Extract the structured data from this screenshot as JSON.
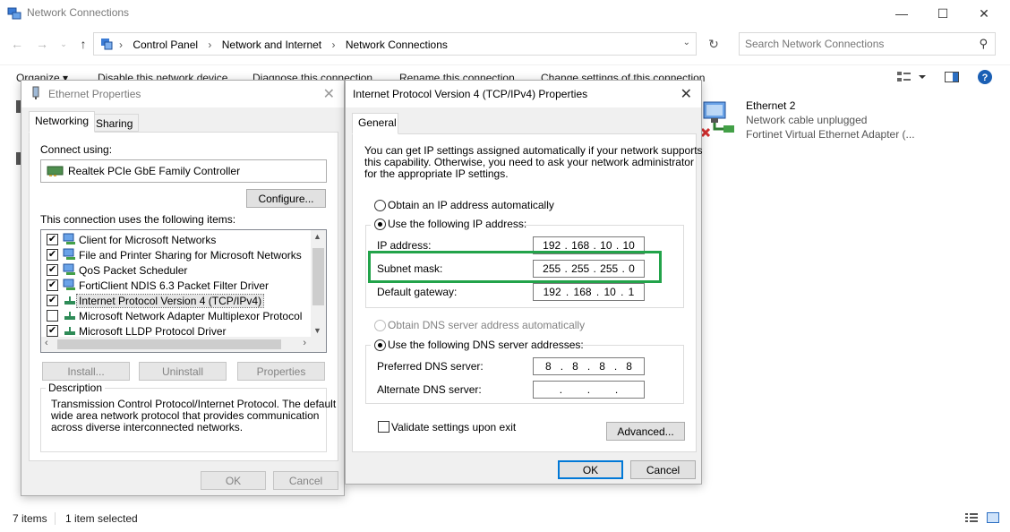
{
  "explorer": {
    "title": "Network Connections",
    "breadcrumbs": [
      "Control Panel",
      "Network and Internet",
      "Network Connections"
    ],
    "search_placeholder": "Search Network Connections",
    "commands": [
      "Organize ▾",
      "Disable this network device",
      "Diagnose this connection",
      "Rename this connection",
      "Change settings of this connection"
    ],
    "items": [
      {
        "name": "Ethernet 2",
        "status": "Network cable unplugged",
        "adapter": "Fortinet Virtual Ethernet Adapter (..."
      }
    ],
    "status": {
      "count": "7 items",
      "selected": "1 item selected"
    }
  },
  "eth_props": {
    "title": "Ethernet Properties",
    "tabs": [
      "Networking",
      "Sharing"
    ],
    "connect_using_label": "Connect using:",
    "adapter": "Realtek PCIe GbE Family Controller",
    "configure": "Configure...",
    "items_label": "This connection uses the following items:",
    "items": [
      {
        "label": "Client for Microsoft Networks",
        "checked": true
      },
      {
        "label": "File and Printer Sharing for Microsoft Networks",
        "checked": true
      },
      {
        "label": "QoS Packet Scheduler",
        "checked": true
      },
      {
        "label": "FortiClient NDIS 6.3 Packet Filter Driver",
        "checked": true
      },
      {
        "label": "Internet Protocol Version 4 (TCP/IPv4)",
        "checked": true
      },
      {
        "label": "Microsoft Network Adapter Multiplexor Protocol",
        "checked": false
      },
      {
        "label": "Microsoft LLDP Protocol Driver",
        "checked": true
      }
    ],
    "install": "Install...",
    "uninstall": "Uninstall",
    "properties": "Properties",
    "description_label": "Description",
    "description": [
      "Transmission Control Protocol/Internet Protocol. The default",
      "wide area network protocol that provides communication",
      "across diverse interconnected networks."
    ],
    "ok": "OK",
    "cancel": "Cancel"
  },
  "ipv4": {
    "title": "Internet Protocol Version 4 (TCP/IPv4) Properties",
    "tab": "General",
    "intro": [
      "You can get IP settings assigned automatically if your network supports",
      "this capability. Otherwise, you need to ask your network administrator",
      "for the appropriate IP settings."
    ],
    "auto_ip": "Obtain an IP address automatically",
    "manual_ip": "Use the following IP address:",
    "ip_label": "IP address:",
    "ip": [
      "192",
      "168",
      "10",
      "10"
    ],
    "mask_label": "Subnet mask:",
    "mask": [
      "255",
      "255",
      "255",
      "0"
    ],
    "gw_label": "Default gateway:",
    "gw": [
      "192",
      "168",
      "10",
      "1"
    ],
    "auto_dns": "Obtain DNS server address automatically",
    "manual_dns": "Use the following DNS server addresses:",
    "pdns_label": "Preferred DNS server:",
    "pdns": [
      "8",
      "8",
      "8",
      "8"
    ],
    "adns_label": "Alternate DNS server:",
    "adns": [
      "",
      "",
      "",
      ""
    ],
    "validate": "Validate settings upon exit",
    "advanced": "Advanced...",
    "ok": "OK",
    "cancel": "Cancel"
  },
  "colors": {
    "highlight": "#22a34a",
    "accent": "#0078d7"
  }
}
